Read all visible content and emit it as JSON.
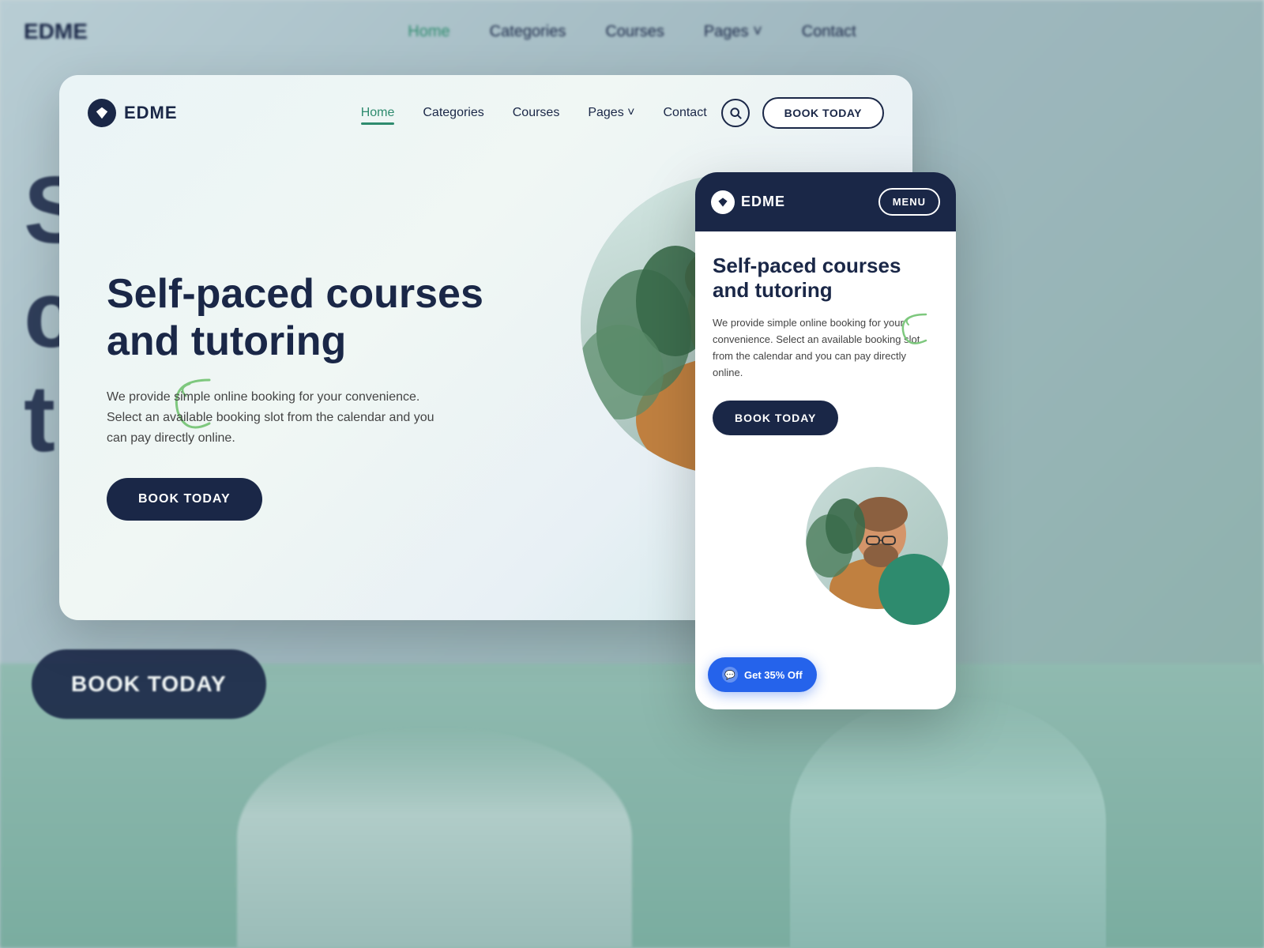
{
  "brand": {
    "logo_text": "EDME",
    "logo_icon": "diamond"
  },
  "background": {
    "blurred_text_lines": [
      "S",
      "c",
      "tu"
    ],
    "tagline_partial": "We provide simple online booking...",
    "book_btn_label": "BOOK TODAY"
  },
  "desktop_card": {
    "nav": {
      "logo": "EDME",
      "links": [
        "Home",
        "Categories",
        "Courses",
        "Pages ˅",
        "Contact"
      ],
      "active_link": "Home",
      "search_label": "search",
      "book_btn": "BOOK TODAY"
    },
    "hero": {
      "title": "Self-paced courses and tutoring",
      "description": "We provide simple online booking for your convenience. Select an available booking slot from the calendar and you can pay directly online.",
      "cta_label": "BOOK TODAY"
    }
  },
  "mobile_card": {
    "nav": {
      "logo": "EDME",
      "menu_btn": "MENU"
    },
    "hero": {
      "title": "Self-paced courses and tutoring",
      "description": "We provide simple online booking for your convenience. Select an available booking slot from the calendar and you can pay directly online.",
      "cta_label": "BOOK TODAY"
    },
    "chat_btn": "Get 35% Off"
  }
}
